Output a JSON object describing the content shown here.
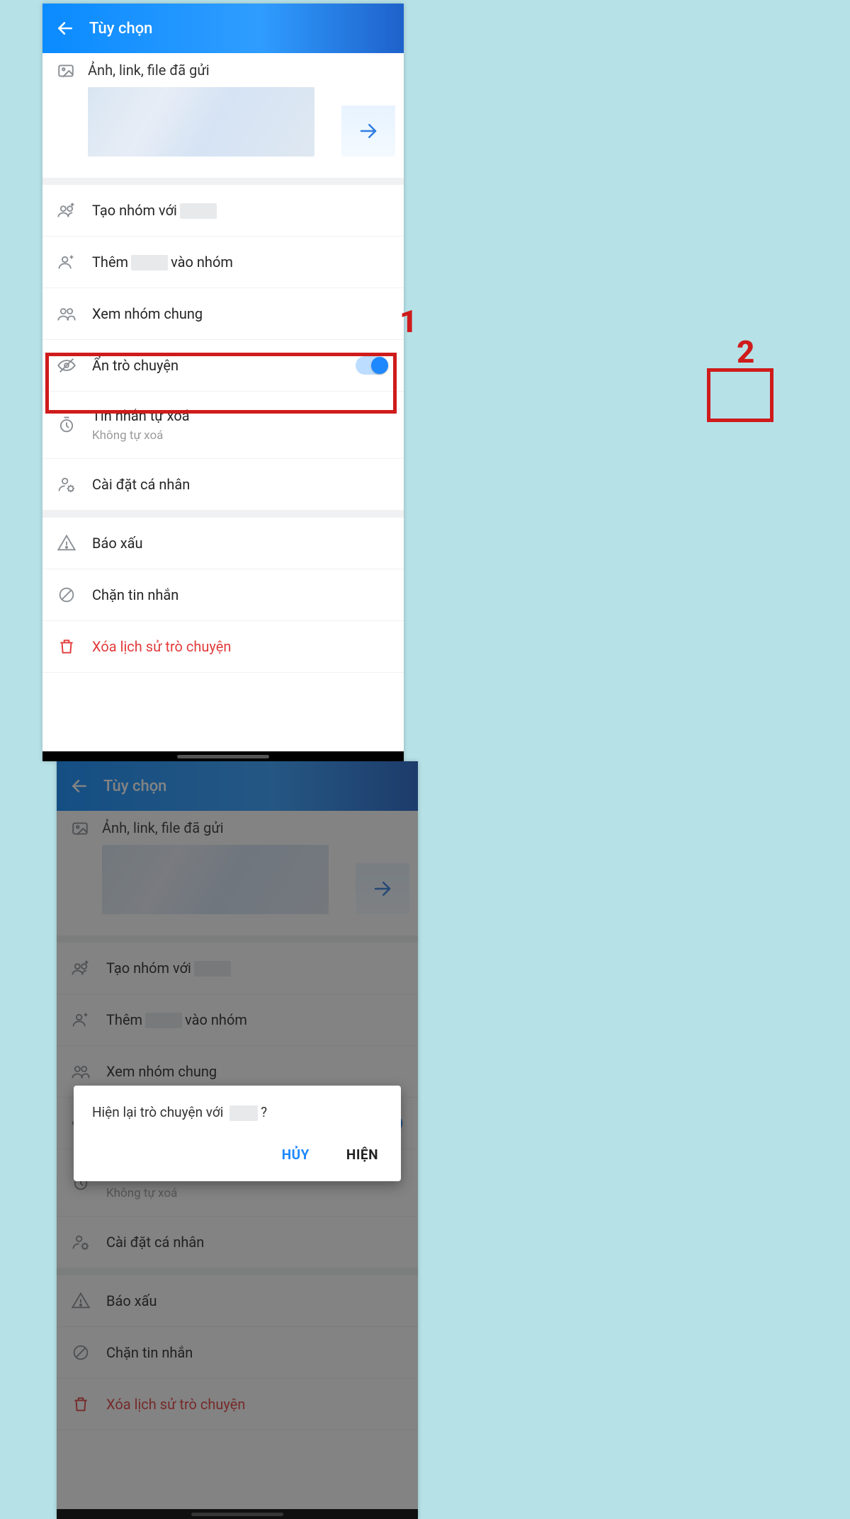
{
  "header": {
    "title": "Tùy chọn"
  },
  "media": {
    "title": "Ảnh, link, file đã gửi"
  },
  "rows": {
    "createGroup_prefix": "Tạo nhóm với",
    "addToGroup_prefix": "Thêm",
    "addToGroup_suffix": "vào nhóm",
    "viewCommon": "Xem nhóm chung",
    "hideChat": "Ẩn trò chuyện",
    "autoDelete": "Tin nhắn tự xoá",
    "autoDelete_sub": "Không tự xoá",
    "personal": "Cài đặt cá nhân",
    "report": "Báo xấu",
    "block": "Chặn tin nhắn",
    "deleteHistory": "Xóa lịch sử trò chuyện"
  },
  "dialog": {
    "msg_prefix": "Hiện lại trò chuyện với",
    "msg_suffix": "?",
    "cancel": "HỦY",
    "confirm": "HIỆN"
  },
  "steps": {
    "one": "1",
    "two": "2"
  }
}
